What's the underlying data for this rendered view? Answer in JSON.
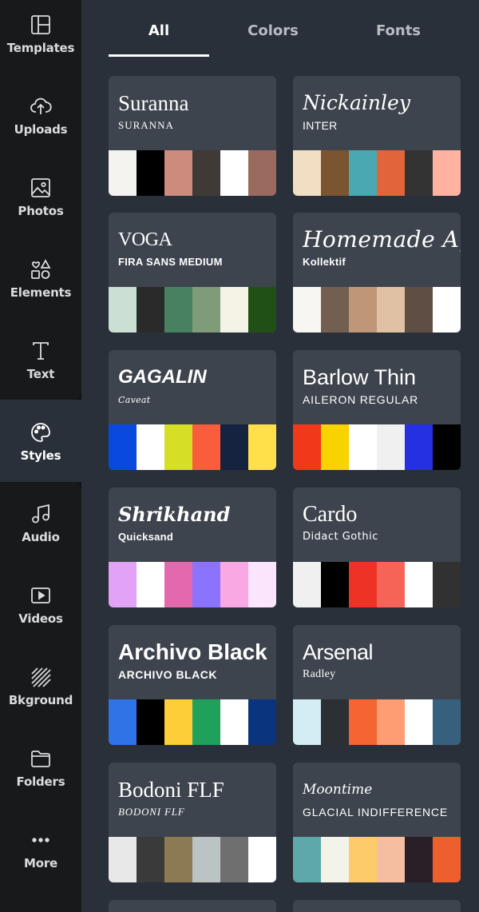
{
  "sidebar": {
    "items": [
      {
        "label": "Templates",
        "icon": "templates-icon"
      },
      {
        "label": "Uploads",
        "icon": "upload-cloud-icon"
      },
      {
        "label": "Photos",
        "icon": "image-icon"
      },
      {
        "label": "Elements",
        "icon": "shapes-icon"
      },
      {
        "label": "Text",
        "icon": "text-t-icon"
      },
      {
        "label": "Styles",
        "icon": "palette-icon"
      },
      {
        "label": "Audio",
        "icon": "music-note-icon"
      },
      {
        "label": "Videos",
        "icon": "video-play-icon"
      },
      {
        "label": "Bkground",
        "icon": "background-stripes-icon"
      },
      {
        "label": "Folders",
        "icon": "folder-icon"
      },
      {
        "label": "More",
        "icon": "more-dots-icon"
      }
    ],
    "active": "Styles"
  },
  "tabs": [
    {
      "label": "All"
    },
    {
      "label": "Colors"
    },
    {
      "label": "Fonts"
    }
  ],
  "active_tab": "All",
  "styles": [
    {
      "title": "Suranna",
      "subtitle": "SURANNA",
      "colors": [
        "#f4f3ef",
        "#000000",
        "#cc8b7d",
        "#403a37",
        "#ffffff",
        "#9a6a5f"
      ]
    },
    {
      "title": "Nickainley",
      "subtitle": "INTER",
      "colors": [
        "#f2dfc3",
        "#7b5531",
        "#4aa8b2",
        "#e2643a",
        "#333333",
        "#ffb2a0"
      ]
    },
    {
      "title": "VOGA",
      "subtitle": "FIRA SANS MEDIUM",
      "colors": [
        "#cbdfd4",
        "#2a2a2a",
        "#478161",
        "#7f9c79",
        "#f4f4e6",
        "#215016"
      ]
    },
    {
      "title": "Homemade Apple",
      "subtitle": "Kollektif",
      "colors": [
        "#f7f6f3",
        "#735f50",
        "#c09679",
        "#e0c1a4",
        "#5e4e43",
        "#ffffff"
      ]
    },
    {
      "title": "GAGALIN",
      "subtitle": "Caveat",
      "colors": [
        "#0a49e0",
        "#ffffff",
        "#d6df26",
        "#fa5d3d",
        "#152240",
        "#ffe04b"
      ]
    },
    {
      "title": "Barlow Thin",
      "subtitle": "AILERON REGULAR",
      "colors": [
        "#f0391b",
        "#f8d300",
        "#ffffff",
        "#f0f0f0",
        "#2530e3",
        "#000000"
      ]
    },
    {
      "title": "Shrikhand",
      "subtitle": "Quicksand",
      "colors": [
        "#e2a2f6",
        "#ffffff",
        "#e468ae",
        "#8b73ff",
        "#f9a8e3",
        "#fae5fd"
      ]
    },
    {
      "title": "Cardo",
      "subtitle": "Didact Gothic",
      "colors": [
        "#f0f0f0",
        "#000000",
        "#ee3326",
        "#f56457",
        "#ffffff",
        "#313131"
      ]
    },
    {
      "title": "Archivo Black",
      "subtitle": "ARCHIVO BLACK",
      "colors": [
        "#2f73e7",
        "#000000",
        "#fdce37",
        "#1fa05b",
        "#ffffff",
        "#0a347d"
      ]
    },
    {
      "title": "Arsenal",
      "subtitle": "Radley",
      "colors": [
        "#d4edf5",
        "#2c2f34",
        "#f56531",
        "#fe9c73",
        "#ffffff",
        "#36607d"
      ]
    },
    {
      "title": "Bodoni FLF",
      "subtitle": "BODONI FLF",
      "colors": [
        "#e8e8e8",
        "#3a3a3a",
        "#8c7a55",
        "#bbc3c5",
        "#6f6f6f",
        "#ffffff"
      ]
    },
    {
      "title": "Moontime",
      "subtitle": "GLACIAL INDIFFERENCE",
      "colors": [
        "#5ea8aa",
        "#f3f3ea",
        "#fecb6a",
        "#f5bea1",
        "#2a1f27",
        "#ef5e2f"
      ]
    }
  ]
}
